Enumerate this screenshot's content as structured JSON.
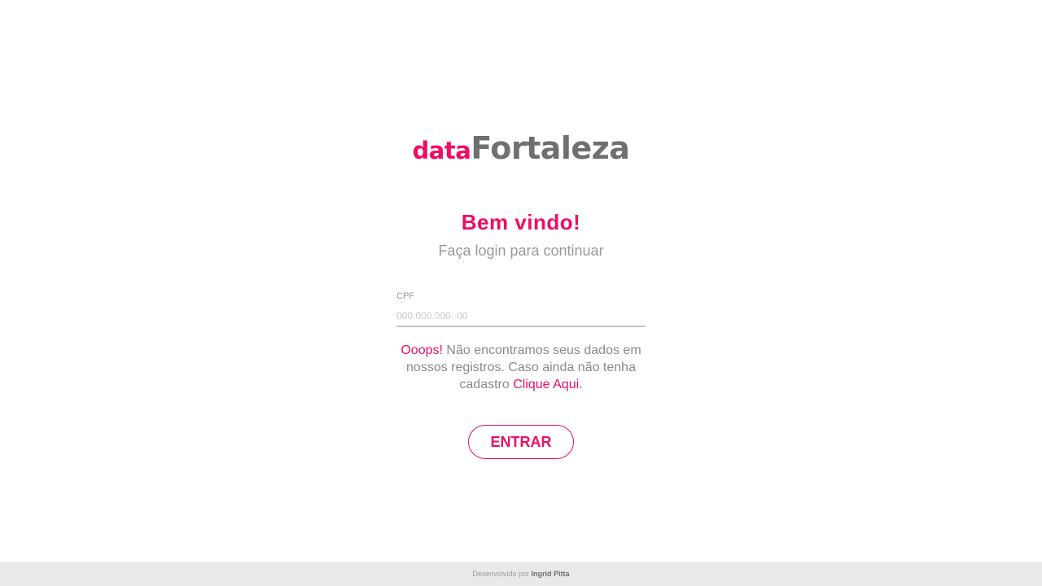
{
  "logo": {
    "prefix": "data",
    "name": "Fortaleza"
  },
  "welcome": {
    "title": "Bem vindo!",
    "subtitle": "Faça login para continuar"
  },
  "form": {
    "cpf_label": "CPF",
    "cpf_placeholder": "000.000.000.-00",
    "cpf_value": ""
  },
  "error": {
    "oops": "Ooops!",
    "text": " Não encontramos seus dados em nossos registros. Caso ainda não tenha cadastro ",
    "link": "Clique Aqui",
    "end": "."
  },
  "actions": {
    "enter_label": "ENTRAR"
  },
  "footer": {
    "developed_by": "Desenvolvido por ",
    "author": "Ingrid Pitta"
  },
  "colors": {
    "accent": "#f20c63",
    "text_gray": "#6f6f6f",
    "footer_bg": "#e9e9e9"
  }
}
